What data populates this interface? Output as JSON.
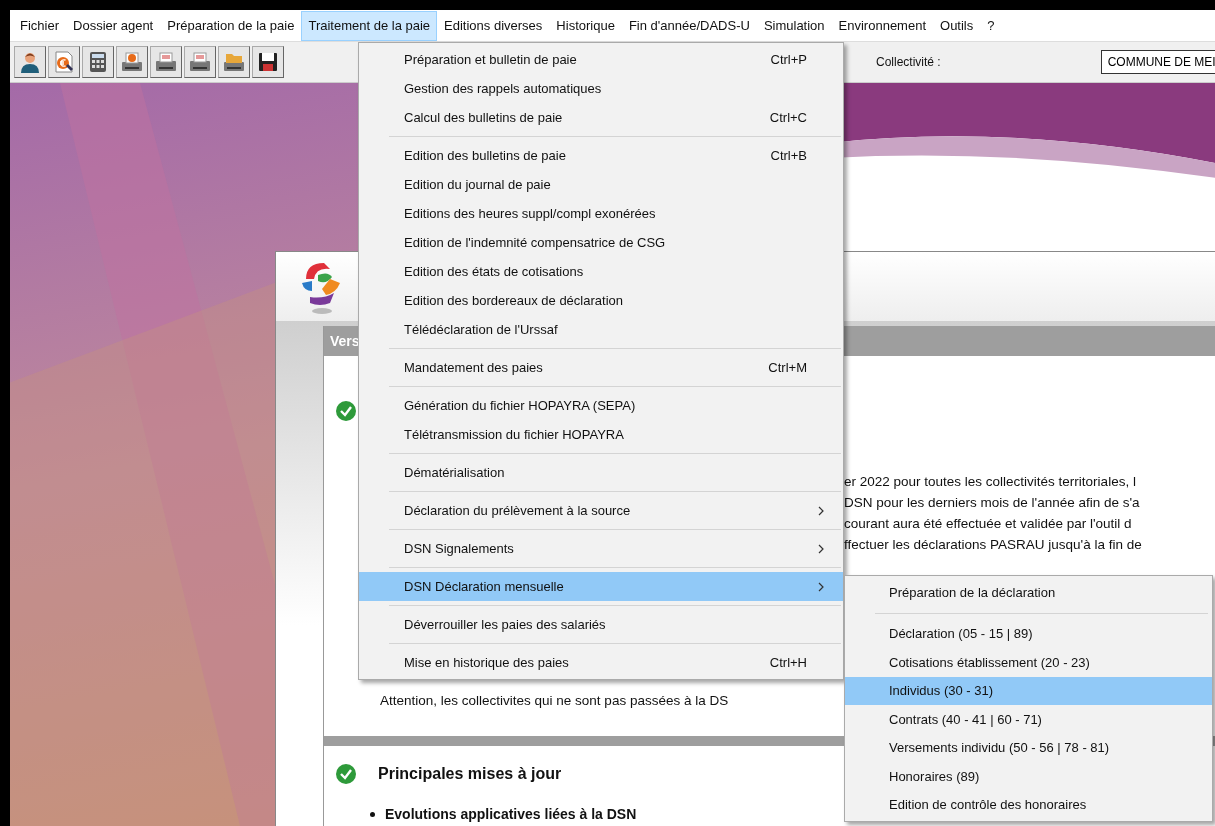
{
  "menubar": [
    {
      "label": "Fichier",
      "selected": false
    },
    {
      "label": "Dossier agent",
      "selected": false
    },
    {
      "label": "Préparation de la paie",
      "selected": false
    },
    {
      "label": "Traitement de la paie",
      "selected": true
    },
    {
      "label": "Editions diverses",
      "selected": false
    },
    {
      "label": "Historique",
      "selected": false
    },
    {
      "label": "Fin d'année/DADS-U",
      "selected": false
    },
    {
      "label": "Simulation",
      "selected": false
    },
    {
      "label": "Environnement",
      "selected": false
    },
    {
      "label": "Outils",
      "selected": false
    },
    {
      "label": "?",
      "selected": false
    }
  ],
  "toolbar": {
    "buttons": [
      {
        "kind": "person"
      },
      {
        "kind": "euro-document"
      },
      {
        "kind": "calculator"
      },
      {
        "kind": "euro-printer"
      },
      {
        "kind": "printer"
      },
      {
        "kind": "printer"
      },
      {
        "kind": "folder-printer"
      },
      {
        "kind": "floppy"
      }
    ],
    "collectivite": {
      "label": "Collectivité :",
      "value": "COMMUNE DE MEI"
    }
  },
  "window": {
    "sections": [
      {
        "header": "Vers",
        "lines": [
          "er 2022 pour toutes les collectivités territoriales, l",
          "DSN pour les derniers mois de l'année afin de s'a",
          "courant aura été effectuée et validée par l'outil d",
          "ffectuer les déclarations PASRAU jusqu'à la fin de"
        ],
        "note": "Attention, les collectivites qui ne sont pas passées à la DS"
      },
      {
        "title": "Principales mises à jour",
        "bullets": [
          "Evolutions applicatives liées à la DSN"
        ]
      }
    ]
  },
  "menu": {
    "groups": [
      [
        {
          "label": "Préparation et bulletin de paie",
          "shortcut": "Ctrl+P",
          "submenu": false,
          "selected": false
        },
        {
          "label": "Gestion des rappels automatiques",
          "submenu": false,
          "selected": false
        },
        {
          "label": "Calcul des bulletins de paie",
          "shortcut": "Ctrl+C",
          "submenu": false,
          "selected": false
        }
      ],
      [
        {
          "label": "Edition des bulletins de paie",
          "shortcut": "Ctrl+B",
          "submenu": false,
          "selected": false
        },
        {
          "label": "Edition du journal de paie",
          "submenu": false,
          "selected": false
        },
        {
          "label": "Editions des heures suppl/compl exonérées",
          "submenu": false,
          "selected": false
        },
        {
          "label": "Edition de l'indemnité compensatrice de CSG",
          "submenu": false,
          "selected": false
        },
        {
          "label": "Edition des états de cotisations",
          "submenu": false,
          "selected": false
        },
        {
          "label": "Edition des bordereaux de déclaration",
          "submenu": false,
          "selected": false
        },
        {
          "label": "Télédéclaration de l'Urssaf",
          "submenu": false,
          "selected": false
        }
      ],
      [
        {
          "label": "Mandatement des paies",
          "shortcut": "Ctrl+M",
          "submenu": false,
          "selected": false
        }
      ],
      [
        {
          "label": "Génération du fichier HOPAYRA (SEPA)",
          "submenu": false,
          "selected": false
        },
        {
          "label": "Télétransmission du fichier HOPAYRA",
          "submenu": false,
          "selected": false
        }
      ],
      [
        {
          "label": "Dématérialisation",
          "submenu": false,
          "selected": false
        }
      ],
      [
        {
          "label": "Déclaration du prélèvement à la source",
          "submenu": true,
          "selected": false
        }
      ],
      [
        {
          "label": "DSN Signalements",
          "submenu": true,
          "selected": false
        }
      ],
      [
        {
          "label": "DSN Déclaration mensuelle",
          "submenu": true,
          "selected": true
        }
      ],
      [
        {
          "label": "Déverrouiller les paies des salariés",
          "submenu": false,
          "selected": false
        }
      ],
      [
        {
          "label": "Mise en historique des paies",
          "shortcut": "Ctrl+H",
          "submenu": false,
          "selected": false
        }
      ]
    ]
  },
  "submenu": {
    "groups": [
      [
        {
          "label": "Préparation de la déclaration",
          "selected": false
        }
      ],
      [
        {
          "label": "Déclaration (05 - 15 | 89)",
          "selected": false
        },
        {
          "label": "Cotisations établissement (20 - 23)",
          "selected": false
        },
        {
          "label": "Individus (30 - 31)",
          "selected": true
        },
        {
          "label": "Contrats (40 - 41 | 60 - 71)",
          "selected": false
        },
        {
          "label": "Versements individu (50 - 56 | 78 - 81)",
          "selected": false
        },
        {
          "label": "Honoraires (89)",
          "selected": false
        },
        {
          "label": "Edition de contrôle des honoraires",
          "selected": false
        }
      ]
    ]
  }
}
